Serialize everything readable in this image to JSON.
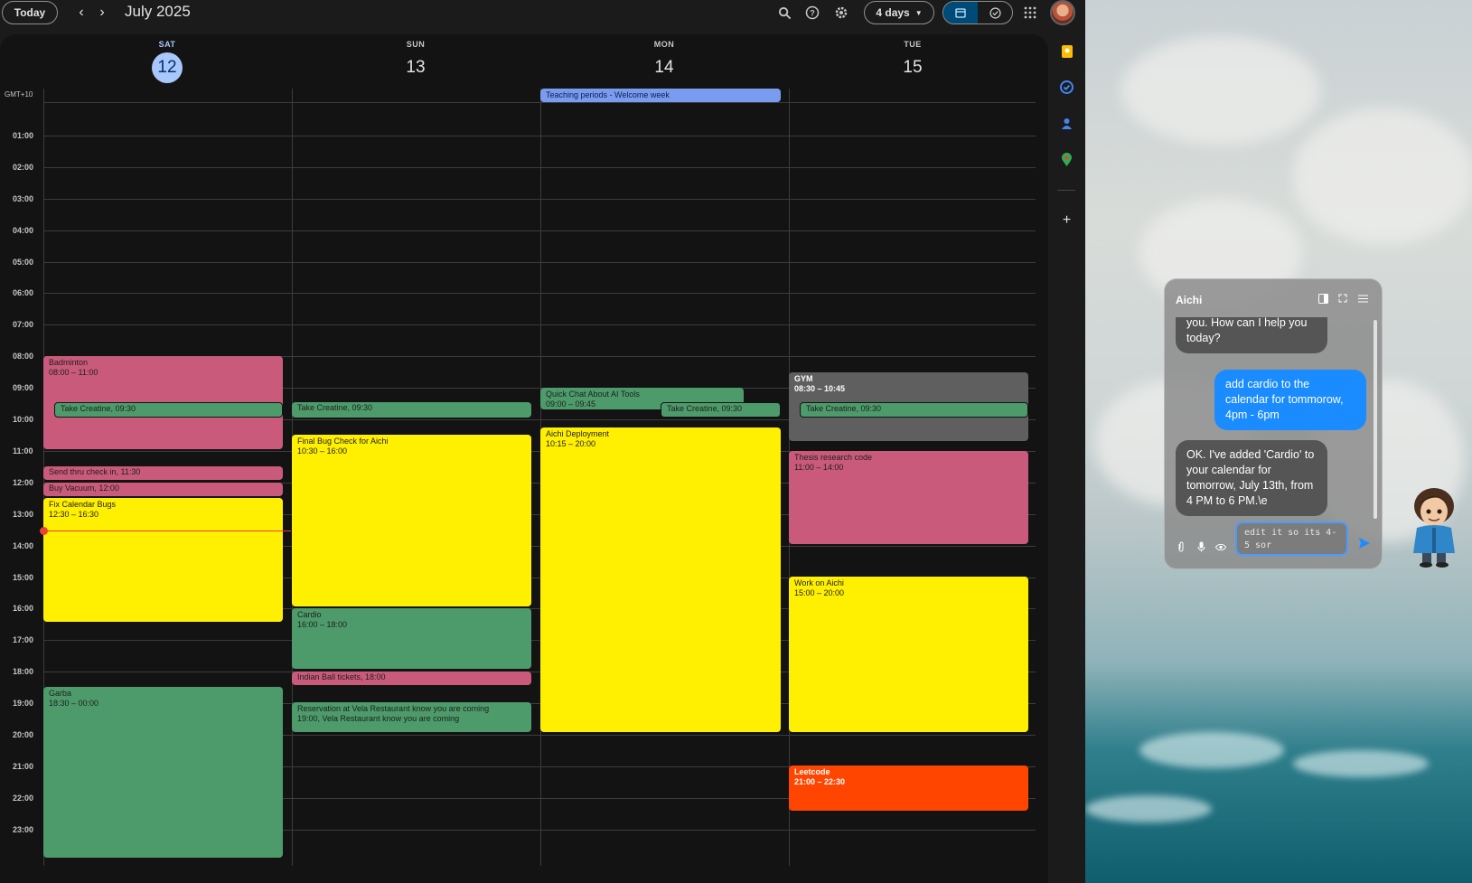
{
  "header": {
    "today_label": "Today",
    "prev_icon": "chevron-left-icon",
    "next_icon": "chevron-right-icon",
    "month_title": "July 2025",
    "view_select": "4 days",
    "icons": [
      "search-icon",
      "help-icon",
      "settings-icon",
      "apps-grid-icon"
    ]
  },
  "timezone": "GMT+10",
  "days": [
    {
      "name": "SAT",
      "num": "12",
      "today": true
    },
    {
      "name": "SUN",
      "num": "13",
      "today": false
    },
    {
      "name": "MON",
      "num": "14",
      "today": false
    },
    {
      "name": "TUE",
      "num": "15",
      "today": false
    }
  ],
  "hours": [
    "01:00",
    "02:00",
    "03:00",
    "04:00",
    "05:00",
    "06:00",
    "07:00",
    "08:00",
    "09:00",
    "10:00",
    "11:00",
    "12:00",
    "13:00",
    "14:00",
    "15:00",
    "16:00",
    "17:00",
    "18:00",
    "19:00",
    "20:00",
    "21:00",
    "22:00",
    "23:00"
  ],
  "events": {
    "allday_teaching": "Teaching periods - Welcome week",
    "sat_badminton_title": "Badminton",
    "sat_badminton_time": "08:00 – 11:00",
    "sat_creatine": "Take Creatine, 09:30",
    "sat_send_thru": "Send thru check in, 11:30",
    "sat_vacuum": "Buy Vacuum, 12:00",
    "sat_fix_title": "Fix Calendar Bugs",
    "sat_fix_time": "12:30 – 16:30",
    "sat_garba_title": "Garba",
    "sat_garba_time": "18:30 – 00:00",
    "sun_creatine": "Take Creatine, 09:30",
    "sun_bug_title": "Final Bug Check for Aichi",
    "sun_bug_time": "10:30 – 16:00",
    "sun_cardio_title": "Cardio",
    "sun_cardio_time": "16:00 – 18:00",
    "sun_indian": "Indian Ball tickets, 18:00",
    "sun_vela_title": "Reservation at Vela Restaurant know you are coming",
    "sun_vela_time": "19:00, Vela Restaurant know you are coming",
    "mon_quick_title": "Quick Chat About AI Tools",
    "mon_quick_time": "09:00 – 09:45",
    "mon_creatine": "Take Creatine, 09:30",
    "mon_deploy_title": "Aichi Deployment",
    "mon_deploy_time": "10:15 – 20:00",
    "tue_gym_title": "GYM",
    "tue_gym_time": "08:30 – 10:45",
    "tue_creatine": "Take Creatine, 09:30",
    "tue_thesis_title": "Thesis research code",
    "tue_thesis_time": "11:00 – 14:00",
    "tue_work_title": "Work on Aichi",
    "tue_work_time": "15:00 – 20:00",
    "tue_leet_title": "Leetcode",
    "tue_leet_time": "21:00 – 22:30"
  },
  "side_panel": {
    "icons": [
      "keep-icon",
      "tasks-icon",
      "contacts-icon",
      "maps-icon",
      "add-icon"
    ]
  },
  "chat": {
    "title": "Aichi",
    "messages": [
      {
        "role": "bot",
        "text": "you. How can I help you today?"
      },
      {
        "role": "user",
        "text": "add cardio to the calendar for tommorow, 4pm - 6pm"
      },
      {
        "role": "bot",
        "text": "OK. I've added 'Cardio' to your calendar for tomorrow, July 13th, from 4 PM to 6 PM.\\e"
      }
    ],
    "input_value": "edit it so its 4-5 sor",
    "tools": [
      "attach-icon",
      "mic-icon",
      "eye-icon"
    ],
    "send_icon": "send-icon"
  },
  "colors": {
    "pink": "#c95a7b",
    "yellow": "#ffef00",
    "green": "#4d9b6a",
    "gray": "#5f5f5f",
    "orange": "#ff4500",
    "blue": "#7a9cf0",
    "today_accent": "#a8c7fa",
    "user_bubble": "#1a8cff"
  }
}
